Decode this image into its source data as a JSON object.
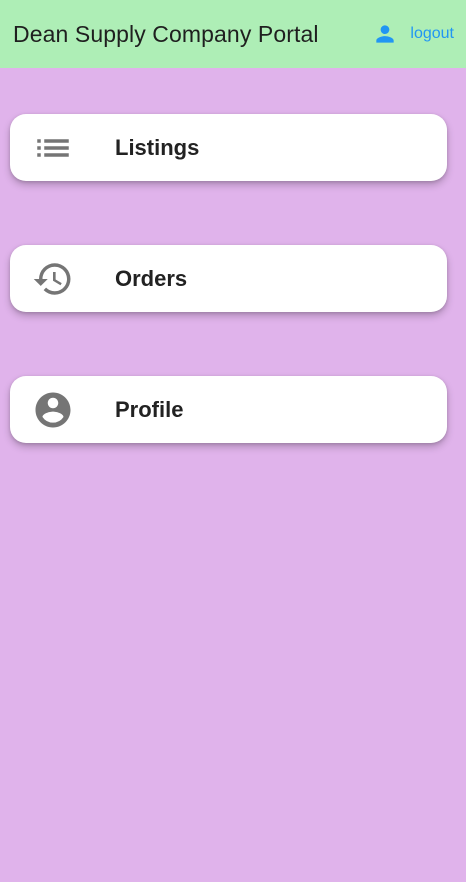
{
  "app": {
    "title": "Dean Supply Company Portal",
    "logout_label": "logout",
    "logout_icon": "person-icon"
  },
  "menu": {
    "items": [
      {
        "label": "Listings",
        "icon": "list-icon"
      },
      {
        "label": "Orders",
        "icon": "history-icon"
      },
      {
        "label": "Profile",
        "icon": "account-circle-icon"
      }
    ]
  },
  "colors": {
    "appbar_bg": "#aeeeb6",
    "page_bg": "#e0b3eb",
    "accent": "#2196f3",
    "icon_gray": "#757575",
    "card_bg": "#ffffff"
  }
}
